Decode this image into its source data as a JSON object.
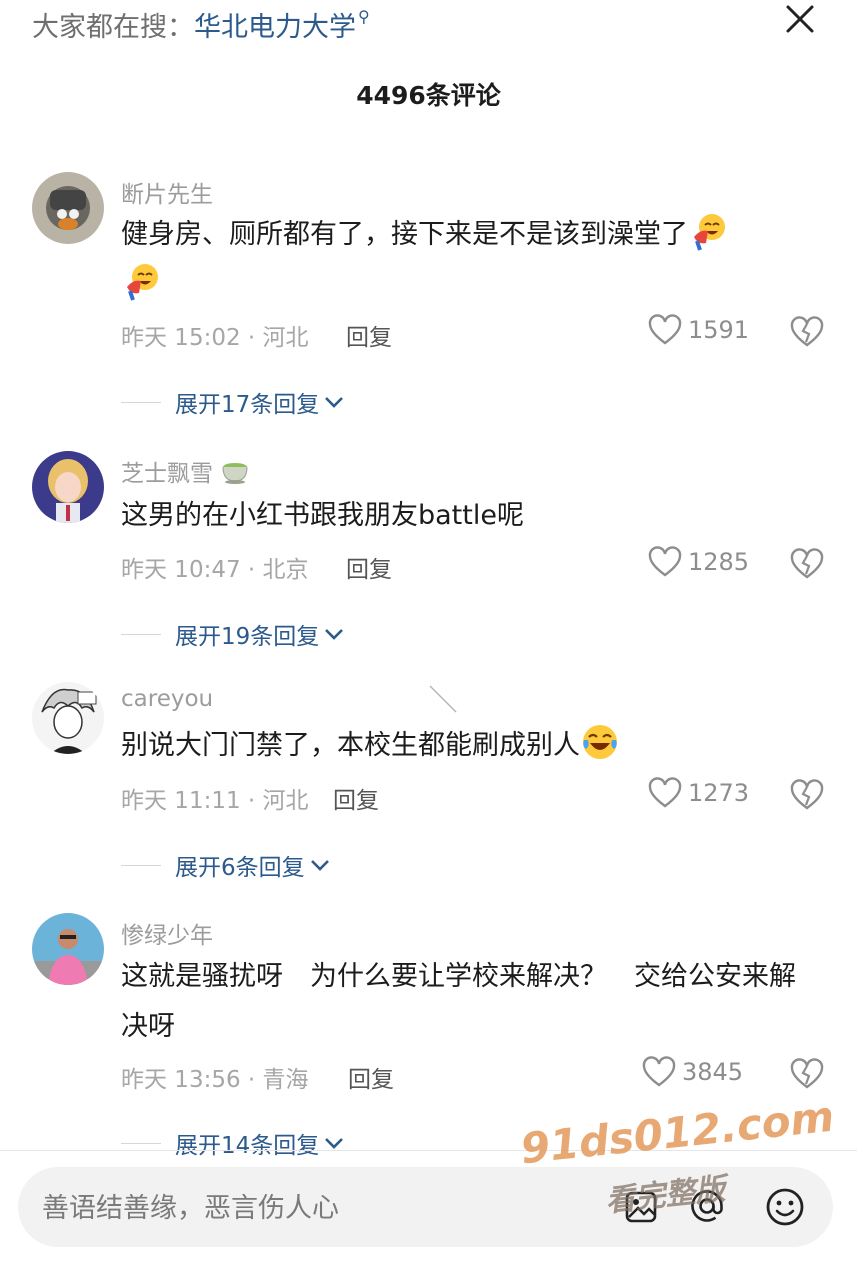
{
  "search": {
    "prefix": "大家都在搜：",
    "term": "华北电力大学",
    "glyph": "⚲"
  },
  "comments_title": "4496条评论",
  "comments": [
    {
      "username": "断片先生",
      "text": "健身房、厕所都有了，接下来是不是该到澡堂了",
      "emoji": "laughing-emoji-icon",
      "time": "昨天 15:02 · 河北",
      "reply_label": "回复",
      "likes": "1591",
      "expand_label": "展开17条回复"
    },
    {
      "username": "芝士飘雪",
      "text": "这男的在小红书跟我朋友battle呢",
      "time": "昨天 10:47 · 北京",
      "reply_label": "回复",
      "likes": "1285",
      "expand_label": "展开19条回复"
    },
    {
      "username": "careyou",
      "text": "别说大门门禁了，本校生都能刷成别人",
      "time": "昨天 11:11 · 河北",
      "reply_label": "回复",
      "likes": "1273",
      "expand_label": "展开6条回复"
    },
    {
      "username": "惨绿少年",
      "text": "这就是骚扰呀　为什么要让学校来解决？　交给公安来解决呀",
      "time": "昨天 13:56 · 青海",
      "reply_label": "回复",
      "likes": "3845",
      "expand_label": "展开14条回复"
    }
  ],
  "input": {
    "placeholder": "善语结善缘，恶言伤人心"
  },
  "watermark": {
    "line1": "91ds012.com",
    "line2": "看完整版"
  },
  "colors": {
    "link": "#2c5a8c",
    "muted": "#a6a6a6",
    "text": "#1c1c1c",
    "input_bg": "#f2f2f2"
  }
}
